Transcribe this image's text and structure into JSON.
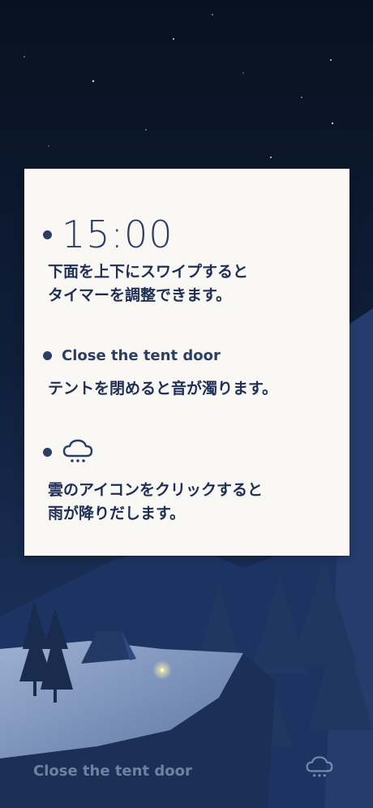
{
  "timer": {
    "value": "15:00",
    "description": "下面を上下にスワイプすると\nタイマーを調整できます。"
  },
  "tent": {
    "heading": "Close the tent door",
    "description": "テントを閉めると音が濁ります。"
  },
  "rain": {
    "icon": "rain-cloud-icon",
    "description": "雲のアイコンをクリックすると\n雨が降りだします。"
  },
  "bottom_bar": {
    "tent_door_label": "Close the tent door",
    "cloud_icon": "rain-cloud-icon"
  },
  "colors": {
    "sky_top": "#0b1628",
    "sky_mid": "#15264a",
    "card_bg": "#f9f8f4",
    "card_text": "#2a3e66",
    "snow": "#8ea3c7"
  }
}
